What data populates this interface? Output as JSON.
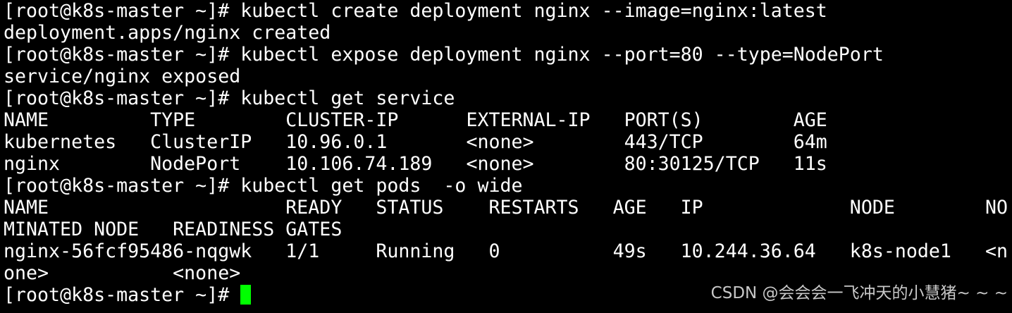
{
  "terminal": {
    "lines": [
      "[root@k8s-master ~]# kubectl create deployment nginx --image=nginx:latest",
      "deployment.apps/nginx created",
      "[root@k8s-master ~]# kubectl expose deployment nginx --port=80 --type=NodePort",
      "service/nginx exposed",
      "[root@k8s-master ~]# kubectl get service",
      "NAME         TYPE        CLUSTER-IP      EXTERNAL-IP   PORT(S)        AGE",
      "kubernetes   ClusterIP   10.96.0.1       <none>        443/TCP        64m",
      "nginx        NodePort    10.106.74.189   <none>        80:30125/TCP   11s",
      "[root@k8s-master ~]# kubectl get pods  -o wide",
      "NAME                     READY   STATUS    RESTARTS   AGE   IP             NODE        NO",
      "MINATED NODE   READINESS GATES",
      "nginx-56fcf95486-nqgwk   1/1     Running   0          49s   10.244.36.64   k8s-node1   <n",
      "one>           <none>",
      "[root@k8s-master ~]# "
    ],
    "cursor_color": "#00ff00",
    "text_color": "#ffffff",
    "background_color": "#000000"
  },
  "watermark": {
    "text": "CSDN @会会会一飞冲天的小慧猪~ ~ ~"
  }
}
